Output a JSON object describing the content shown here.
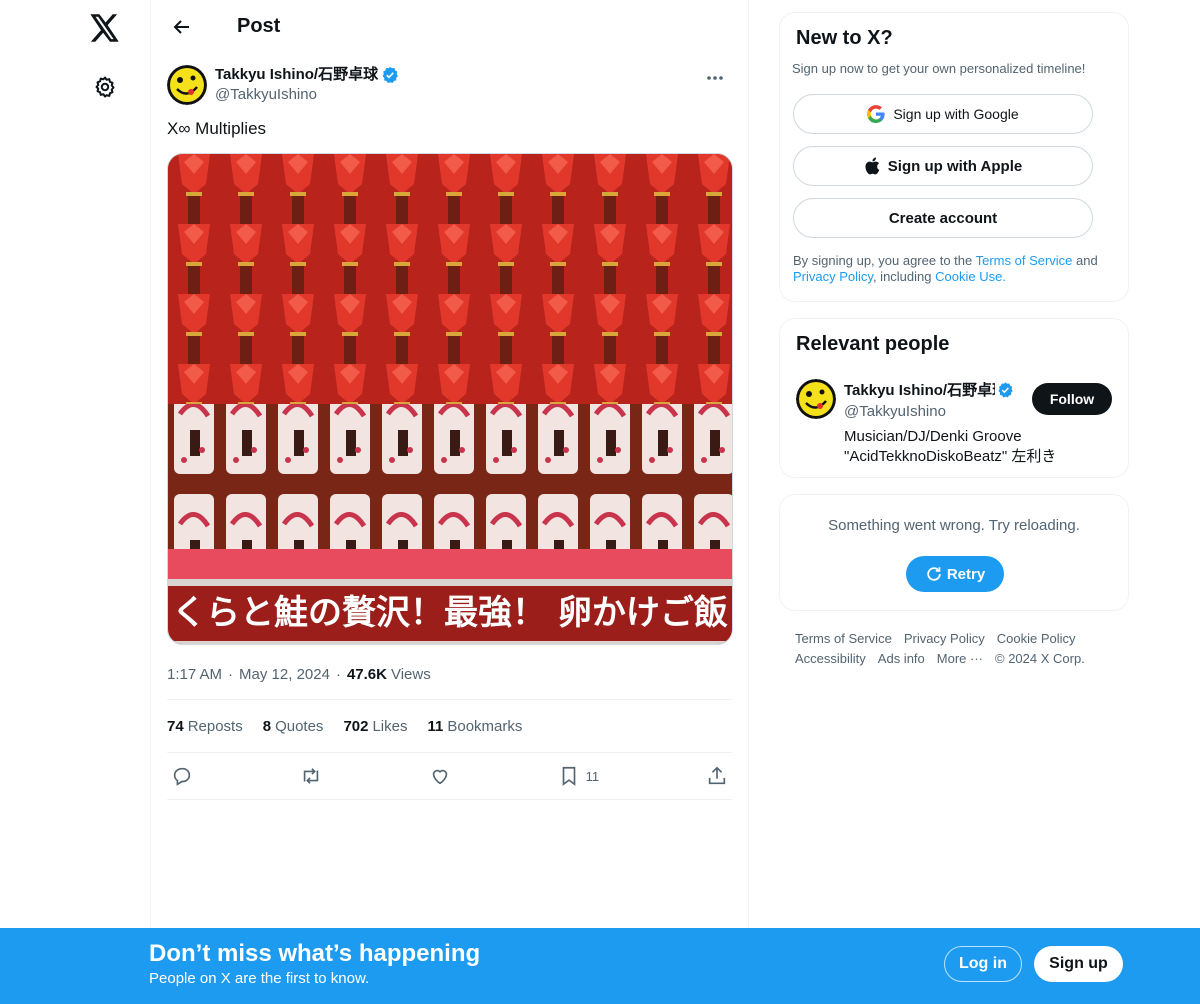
{
  "header": {
    "title": "Post"
  },
  "post": {
    "author_name": "Takkyu Ishino/石野卓球",
    "author_handle": "@TakkyuIshino",
    "text": "X∞ Multiplies",
    "image_caption": "くらと鮭の贅沢！最強！ 卵かけご飯",
    "time": "1:17 AM",
    "date": "May 12, 2024",
    "views_count": "47.6K",
    "views_label": "Views",
    "stats": [
      {
        "count": "74",
        "label": "Reposts"
      },
      {
        "count": "8",
        "label": "Quotes"
      },
      {
        "count": "702",
        "label": "Likes"
      },
      {
        "count": "11",
        "label": "Bookmarks"
      }
    ],
    "bookmark_count": "11"
  },
  "new_to_x": {
    "title": "New to X?",
    "subtitle": "Sign up now to get your own personalized timeline!",
    "google_label": "Sign up with Google",
    "apple_label": "Sign up with Apple",
    "create_label": "Create account",
    "legal_prefix": "By signing up, you agree to the ",
    "terms_label": "Terms of Service",
    "legal_and": " and ",
    "privacy_label": "Privacy Policy",
    "legal_including": ", including ",
    "cookie_label": "Cookie Use."
  },
  "relevant": {
    "title": "Relevant people",
    "name": "Takkyu Ishino/石野卓球",
    "handle": "@TakkyuIshino",
    "bio_line1": "Musician/DJ/Denki Groove",
    "bio_line2": "\"AcidTekknoDiskoBeatz\" 左利き",
    "follow_label": "Follow"
  },
  "error_card": {
    "message": "Something went wrong. Try reloading.",
    "retry_label": "Retry"
  },
  "footer": {
    "links": [
      "Terms of Service",
      "Privacy Policy",
      "Cookie Policy",
      "Accessibility",
      "Ads info",
      "More ···",
      "© 2024 X Corp."
    ]
  },
  "banner": {
    "title": "Don’t miss what’s happening",
    "subtitle": "People on X are the first to know.",
    "login_label": "Log in",
    "signup_label": "Sign up"
  },
  "colors": {
    "accent": "#1d9bf0",
    "text": "#0f1419",
    "muted": "#536471",
    "border": "#eff3f4"
  }
}
